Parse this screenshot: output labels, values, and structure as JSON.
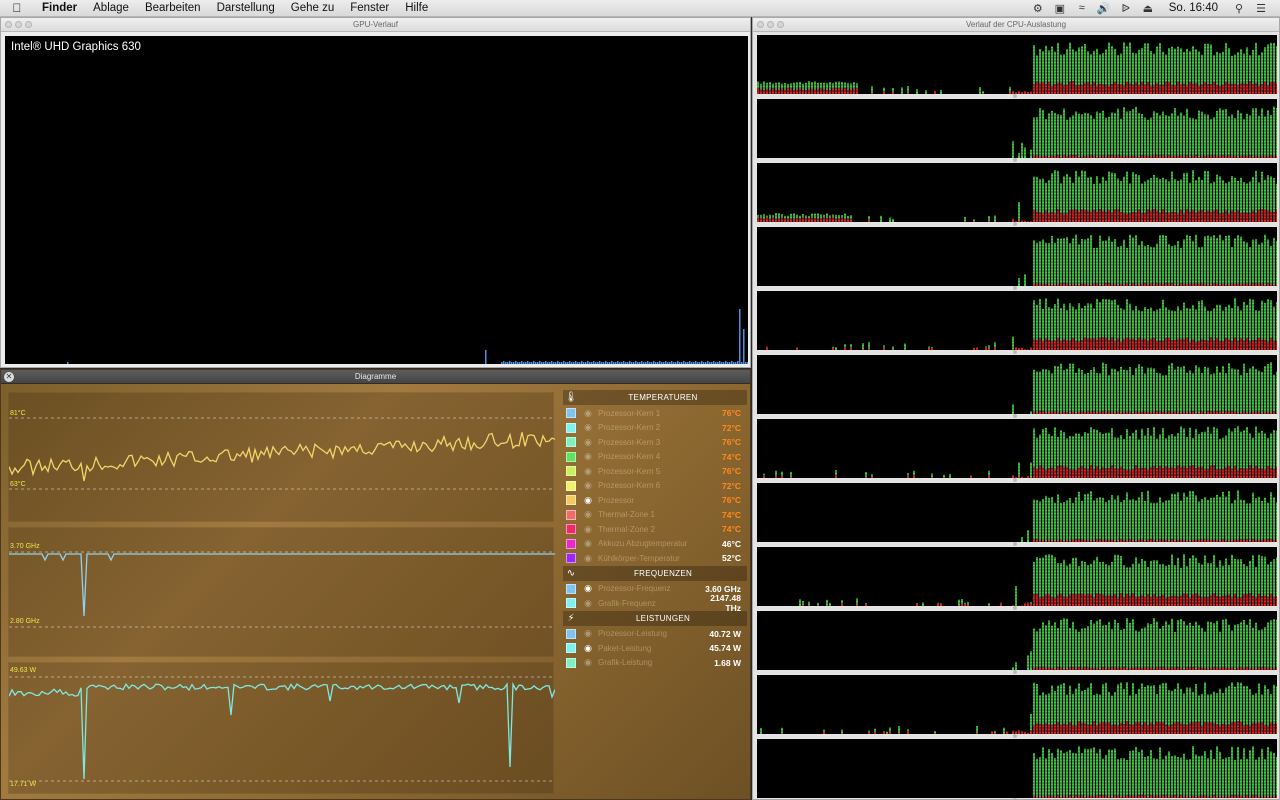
{
  "menubar": {
    "app": "Finder",
    "items": [
      "Ablage",
      "Bearbeiten",
      "Darstellung",
      "Gehe zu",
      "Fenster",
      "Hilfe"
    ],
    "clock": "So. 16:40"
  },
  "gpu_window": {
    "title": "GPU-Verlauf",
    "gpu_name": "Intel® UHD Graphics 630"
  },
  "cpu_window": {
    "title": "Verlauf der CPU-Auslastung",
    "core_count": 12
  },
  "diagram_window": {
    "title": "Diagramme",
    "graphs": [
      {
        "name": "temperature",
        "top_label": "81°C",
        "bottom_label": "63°C",
        "color": "#f2d56a"
      },
      {
        "name": "frequency",
        "top_label": "3.70 GHz",
        "bottom_label": "2.80 GHz",
        "color": "#8fd3ee"
      },
      {
        "name": "power",
        "top_label": "49.63 W",
        "bottom_label": "17.71 W",
        "color": "#7fe8e0"
      }
    ],
    "sections": [
      {
        "title": "TEMPERATUREN",
        "icon": "thermometer-icon",
        "rows": [
          {
            "label": "Prozessor-Kern 1",
            "value": "76°C",
            "color": "#7fc4f0",
            "eye": false,
            "vclass": "orange"
          },
          {
            "label": "Prozessor-Kern 2",
            "value": "72°C",
            "color": "#7ff0ef",
            "eye": false,
            "vclass": "orange"
          },
          {
            "label": "Prozessor-Kern 3",
            "value": "76°C",
            "color": "#7ff0c0",
            "eye": false,
            "vclass": "orange"
          },
          {
            "label": "Prozessor-Kern 4",
            "value": "74°C",
            "color": "#5fe35f",
            "eye": false,
            "vclass": "orange"
          },
          {
            "label": "Prozessor-Kern 5",
            "value": "76°C",
            "color": "#c8f05a",
            "eye": false,
            "vclass": "orange"
          },
          {
            "label": "Prozessor-Kern 6",
            "value": "72°C",
            "color": "#f0f06a",
            "eye": false,
            "vclass": "orange"
          },
          {
            "label": "Prozessor",
            "value": "76°C",
            "color": "#f5c860",
            "eye": true,
            "vclass": "orange"
          },
          {
            "label": "Thermal-Zone 1",
            "value": "74°C",
            "color": "#f26a6a",
            "eye": false,
            "vclass": "orange"
          },
          {
            "label": "Thermal-Zone 2",
            "value": "74°C",
            "color": "#f0286a",
            "eye": false,
            "vclass": "orange"
          },
          {
            "label": "Akkuzu Abzugtemperatur",
            "value": "46°C",
            "color": "#e828c8",
            "eye": false,
            "vclass": "white"
          },
          {
            "label": "Kühlkörper-Temperatur",
            "value": "52°C",
            "color": "#9a28f0",
            "eye": false,
            "vclass": "white"
          }
        ]
      },
      {
        "title": "FREQUENZEN",
        "icon": "frequency-icon",
        "rows": [
          {
            "label": "Prozessor-Frequenz",
            "value": "3.60 GHz",
            "color": "#7fc4f0",
            "eye": true,
            "vclass": "white"
          },
          {
            "label": "Grafik-Frequenz",
            "value": "2147.48 THz",
            "color": "#7ff0ef",
            "eye": false,
            "vclass": "white"
          }
        ]
      },
      {
        "title": "LEISTUNGEN",
        "icon": "lightning-icon",
        "rows": [
          {
            "label": "Prozessor-Leistung",
            "value": "40.72 W",
            "color": "#7fc4f0",
            "eye": false,
            "vclass": "white"
          },
          {
            "label": "Paket-Leistung",
            "value": "45.74 W",
            "color": "#7ff0ef",
            "eye": true,
            "vclass": "white"
          },
          {
            "label": "Grafik-Leistung",
            "value": "1.68 W",
            "color": "#7ff0c0",
            "eye": false,
            "vclass": "white"
          }
        ]
      }
    ]
  }
}
